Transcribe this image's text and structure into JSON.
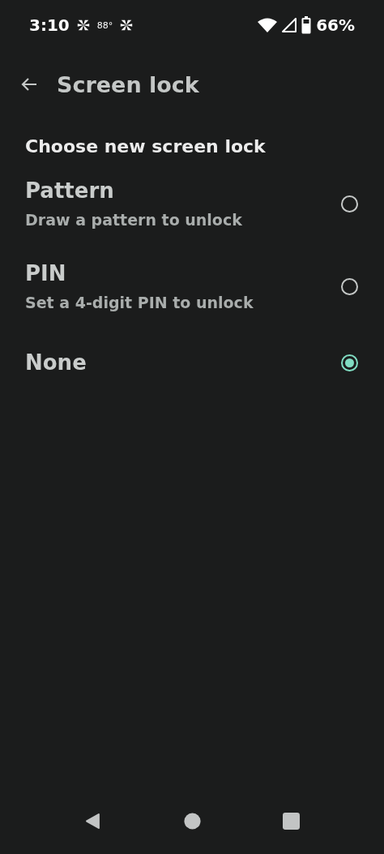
{
  "status_bar": {
    "time": "3:10",
    "temperature": "88°",
    "battery": "66%"
  },
  "app_bar": {
    "title": "Screen lock"
  },
  "section_title": "Choose new screen lock",
  "options": [
    {
      "title": "Pattern",
      "subtitle": "Draw a pattern to unlock",
      "selected": false
    },
    {
      "title": "PIN",
      "subtitle": "Set a 4-digit PIN to unlock",
      "selected": false
    },
    {
      "title": "None",
      "selected": true
    }
  ]
}
